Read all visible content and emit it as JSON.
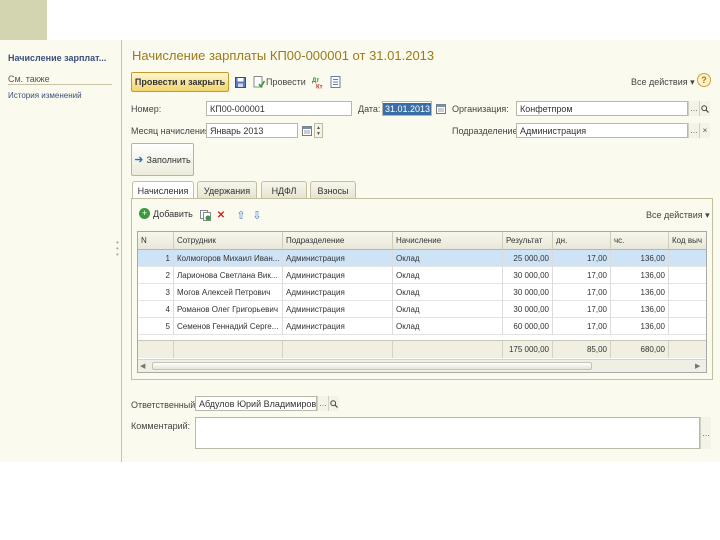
{
  "sidebar": {
    "title": "Начисление зарплат...",
    "see_also": "См. также",
    "history": "История изменений"
  },
  "doc": {
    "title": "Начисление зарплаты КП00-000001 от 31.01.2013"
  },
  "toolbar": {
    "post_close": "Провести и закрыть",
    "post": "Провести",
    "all_actions": "Все действия",
    "help": "?"
  },
  "form": {
    "number_label": "Номер:",
    "number": "КП00-000001",
    "date_label": "Дата:",
    "date": "31.01.2013",
    "org_label": "Организация:",
    "org": "Конфетпром",
    "month_label": "Месяц начисления:",
    "month": "Январь 2013",
    "dept_label": "Подразделение:",
    "dept": "Администрация",
    "fill": "Заполнить"
  },
  "tabs": [
    "Начисления",
    "Удержания",
    "НДФЛ",
    "Взносы"
  ],
  "table_toolbar": {
    "add": "Добавить",
    "all_actions": "Все действия"
  },
  "table": {
    "columns": [
      "N",
      "Сотрудник",
      "Подразделение",
      "Начисление",
      "Результат",
      "дн.",
      "чс.",
      "Код выч"
    ],
    "rows": [
      [
        "1",
        "Колмогоров Михаил Иван...",
        "Администрация",
        "Оклад",
        "25 000,00",
        "17,00",
        "136,00",
        ""
      ],
      [
        "2",
        "Ларионова Светлана Вик...",
        "Администрация",
        "Оклад",
        "30 000,00",
        "17,00",
        "136,00",
        ""
      ],
      [
        "3",
        "Могов Алексей Петрович",
        "Администрация",
        "Оклад",
        "30 000,00",
        "17,00",
        "136,00",
        ""
      ],
      [
        "4",
        "Романов Олег Григорьевич",
        "Администрация",
        "Оклад",
        "30 000,00",
        "17,00",
        "136,00",
        ""
      ],
      [
        "5",
        "Семенов Геннадий Серге...",
        "Администрация",
        "Оклад",
        "60 000,00",
        "17,00",
        "136,00",
        ""
      ]
    ],
    "totals": [
      "",
      "",
      "",
      "",
      "175 000,00",
      "85,00",
      "680,00",
      ""
    ]
  },
  "footer": {
    "responsible_label": "Ответственный:",
    "responsible": "Абдулов Юрий Владимирович",
    "comment_label": "Комментарий:",
    "comment": ""
  },
  "colors": {
    "title": "#9b7a18",
    "primary_button": "#f2d56c",
    "selected_row": "#cfe3f7",
    "panel_bg": "#fbfaee"
  }
}
